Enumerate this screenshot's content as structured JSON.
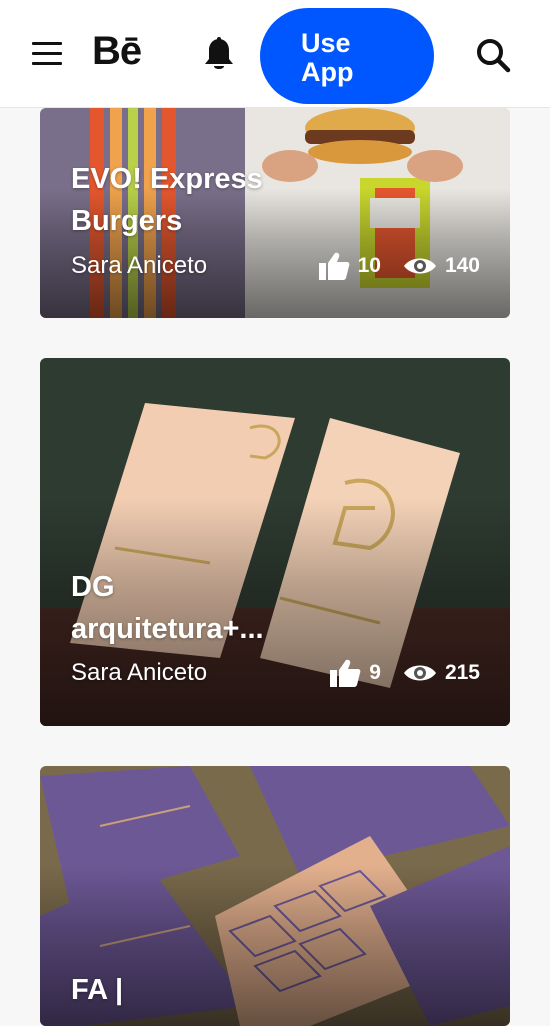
{
  "header": {
    "logo": "Bē",
    "use_app_label": "Use\nApp",
    "icons": [
      "menu-icon",
      "bell-icon",
      "search-icon"
    ]
  },
  "projects": [
    {
      "title": "EVO! Express\nBurgers",
      "owner": "Sara Aniceto",
      "likes": "10",
      "views": "140"
    },
    {
      "title": "DG\narquitetura+...",
      "owner": "Sara Aniceto",
      "likes": "9",
      "views": "215"
    },
    {
      "title": "FA |",
      "owner": "",
      "likes": "",
      "views": ""
    }
  ],
  "colors": {
    "accent": "#0057ff",
    "background": "#f7f7f7"
  }
}
